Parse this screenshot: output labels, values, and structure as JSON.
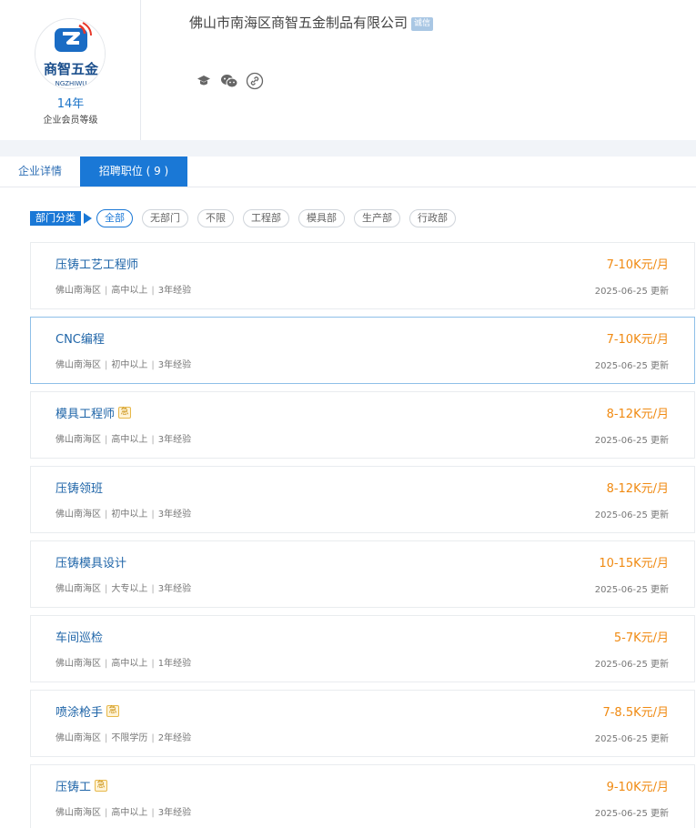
{
  "company": {
    "name": "佛山市南海区商智五金制品有限公司",
    "badge": "诚信",
    "logo_text": "商智五金",
    "logo_subtext": "NGZHIWU",
    "member_years": "14年",
    "member_label": "企业会员等级",
    "social_icons": [
      "graduation-cap-icon",
      "wechat-icon",
      "link-icon"
    ]
  },
  "tabs": [
    {
      "label": "企业详情",
      "active": false
    },
    {
      "label": "招聘职位 ( 9 )",
      "active": true
    }
  ],
  "filter": {
    "label": "部门分类",
    "chips": [
      "全部",
      "无部门",
      "不限",
      "工程部",
      "模具部",
      "生产部",
      "行政部"
    ],
    "active_index": 0
  },
  "jobs": [
    {
      "title": "压铸工艺工程师",
      "tag": "",
      "location": "佛山南海区",
      "education": "高中以上",
      "experience": "3年经验",
      "salary": "7-10K元/月",
      "updated": "2025-06-25 更新"
    },
    {
      "title": "CNC编程",
      "tag": "",
      "location": "佛山南海区",
      "education": "初中以上",
      "experience": "3年经验",
      "salary": "7-10K元/月",
      "updated": "2025-06-25 更新"
    },
    {
      "title": "模具工程师",
      "tag": "急",
      "location": "佛山南海区",
      "education": "高中以上",
      "experience": "3年经验",
      "salary": "8-12K元/月",
      "updated": "2025-06-25 更新"
    },
    {
      "title": "压铸领班",
      "tag": "",
      "location": "佛山南海区",
      "education": "初中以上",
      "experience": "3年经验",
      "salary": "8-12K元/月",
      "updated": "2025-06-25 更新"
    },
    {
      "title": "压铸模具设计",
      "tag": "",
      "location": "佛山南海区",
      "education": "大专以上",
      "experience": "3年经验",
      "salary": "10-15K元/月",
      "updated": "2025-06-25 更新"
    },
    {
      "title": "车间巡检",
      "tag": "",
      "location": "佛山南海区",
      "education": "高中以上",
      "experience": "1年经验",
      "salary": "5-7K元/月",
      "updated": "2025-06-25 更新"
    },
    {
      "title": "喷涂枪手",
      "tag": "急",
      "location": "佛山南海区",
      "education": "不限学历",
      "experience": "2年经验",
      "salary": "7-8.5K元/月",
      "updated": "2025-06-25 更新"
    },
    {
      "title": "压铸工",
      "tag": "急",
      "location": "佛山南海区",
      "education": "高中以上",
      "experience": "3年经验",
      "salary": "9-10K元/月",
      "updated": "2025-06-25 更新"
    }
  ],
  "colors": {
    "accent": "#1a78d6",
    "title_link": "#1f65a8",
    "salary": "#f08a12",
    "urgent_tag": "#e7b84a"
  }
}
